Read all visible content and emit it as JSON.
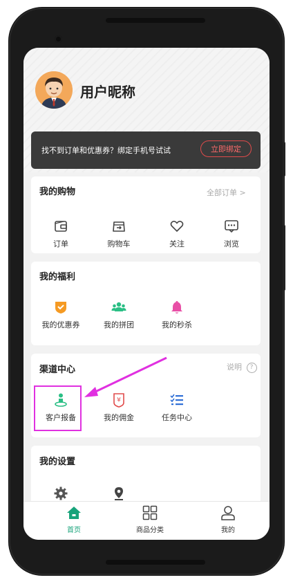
{
  "user": {
    "nickname": "用户昵称"
  },
  "banner": {
    "text": "找不到订单和优惠券？绑定手机号试试",
    "button": "立即绑定"
  },
  "shopping": {
    "title": "我的购物",
    "all_orders": "全部订单 >",
    "items": [
      {
        "label": "订单",
        "icon": "wallet-icon"
      },
      {
        "label": "购物车",
        "icon": "cart-icon"
      },
      {
        "label": "关注",
        "icon": "heart-icon"
      },
      {
        "label": "浏览",
        "icon": "chat-icon"
      }
    ]
  },
  "welfare": {
    "title": "我的福利",
    "items": [
      {
        "label": "我的优惠券",
        "icon": "coupon-shield-icon",
        "color": "#f59a23"
      },
      {
        "label": "我的拼团",
        "icon": "group-icon",
        "color": "#2bbf85"
      },
      {
        "label": "我的秒杀",
        "icon": "bell-icon",
        "color": "#e84fa6"
      }
    ]
  },
  "channel": {
    "title": "渠道中心",
    "info": "说明",
    "items": [
      {
        "label": "客户报备",
        "icon": "customer-location-icon",
        "color": "#2bbf85"
      },
      {
        "label": "我的佣金",
        "icon": "commission-icon",
        "color": "#e14b4b"
      },
      {
        "label": "任务中心",
        "icon": "task-list-icon",
        "color": "#2f6fd6"
      }
    ]
  },
  "settings": {
    "title": "我的设置",
    "items": [
      {
        "icon": "gear-icon"
      },
      {
        "icon": "location-pin-icon"
      }
    ]
  },
  "tabbar": {
    "tabs": [
      {
        "label": "首页",
        "icon": "home-icon",
        "active": true
      },
      {
        "label": "商品分类",
        "icon": "grid-icon",
        "active": false
      },
      {
        "label": "我的",
        "icon": "user-icon",
        "active": false
      }
    ]
  },
  "colors": {
    "accent": "#17a37a",
    "annotation": "#e030e0",
    "banner_bg": "#3a3a3a",
    "banner_button": "#e14b4b"
  }
}
